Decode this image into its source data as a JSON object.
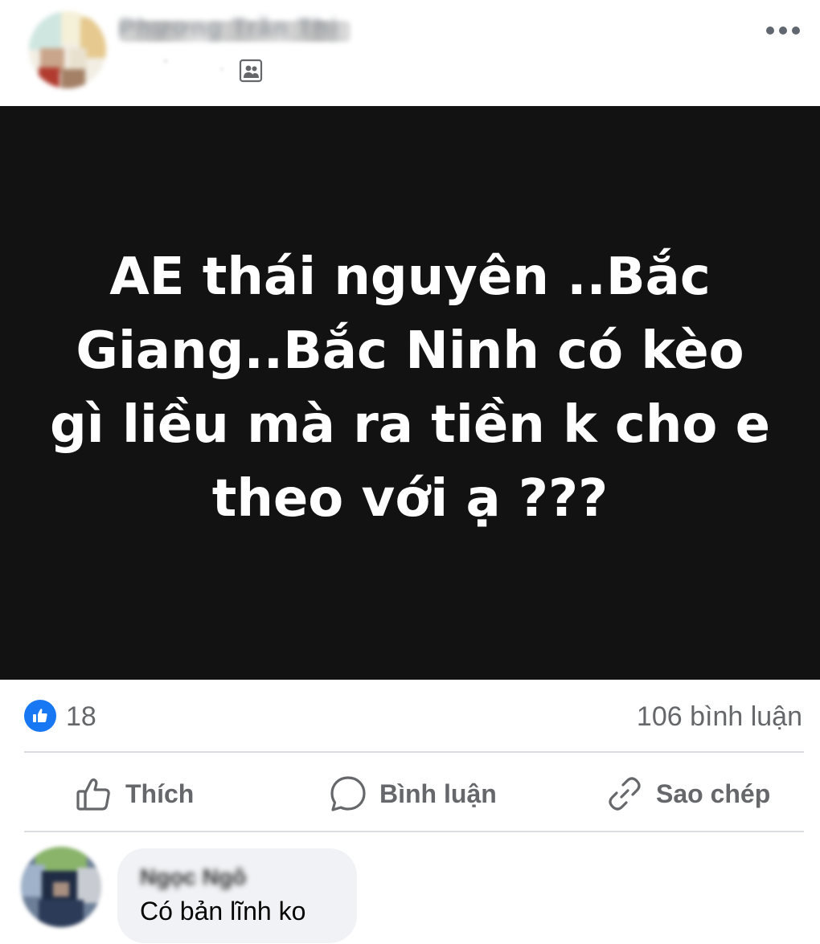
{
  "post": {
    "author_name": "Phương Trần Thị",
    "audience_icon": "friends-audience-icon",
    "more_icon": "more-options-icon",
    "text_lines": [
      "AE thái nguyên ..Bắc",
      "Giang..Bắc Ninh có kèo",
      "gì liều mà ra tiền k cho e",
      "theo với ạ ???"
    ],
    "background_color": "#121212"
  },
  "stats": {
    "reaction_icon": "like-reaction-icon",
    "reaction_count": "18",
    "comment_count": "106 bình luận"
  },
  "actions": {
    "like_label": "Thích",
    "comment_label": "Bình luận",
    "copy_label": "Sao chép"
  },
  "comment": {
    "author_name": "Ngọc Ngô",
    "text": "Có bản lĩnh ko"
  },
  "colors": {
    "accent": "#1877f2",
    "secondary_text": "#65676b",
    "divider": "#dadde1",
    "bubble": "#f0f2f5"
  }
}
